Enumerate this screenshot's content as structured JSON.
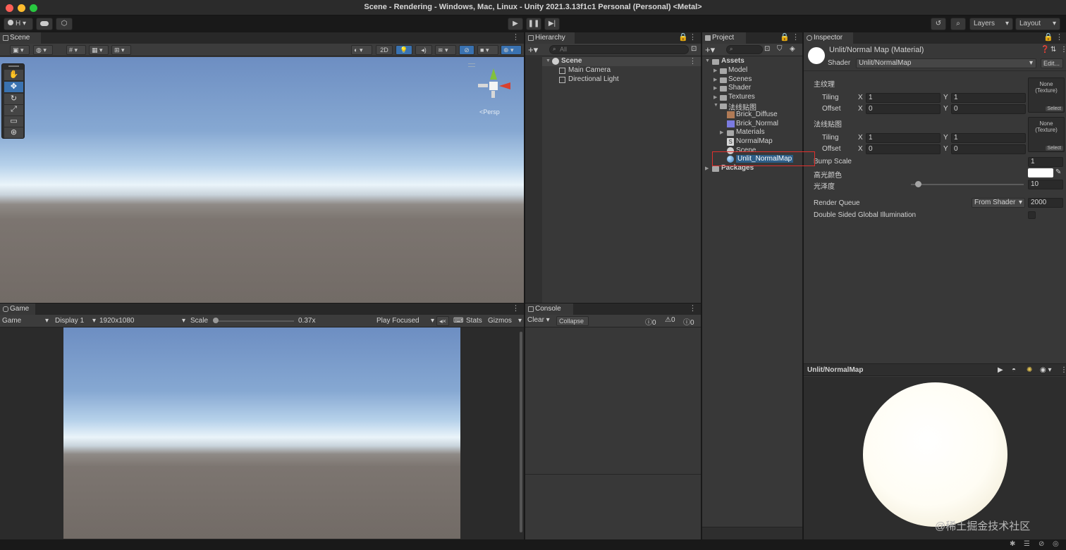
{
  "window": {
    "title": "Scene - Rendering - Windows, Mac, Linux - Unity 2021.3.13f1c1 Personal (Personal) <Metal>"
  },
  "toolbar": {
    "account": "H",
    "layers": "Layers",
    "layout": "Layout"
  },
  "scene": {
    "tab": "Scene",
    "btn_2d": "2D",
    "persp_label": "<Persp"
  },
  "game": {
    "tab": "Game",
    "view_select": "Game",
    "display": "Display 1",
    "resolution": "1920x1080",
    "scale_label": "Scale",
    "scale_value": "0.37x",
    "play_mode": "Play Focused",
    "stats": "Stats",
    "gizmos": "Gizmos"
  },
  "hierarchy": {
    "tab": "Hierarchy",
    "search_placeholder": "All",
    "items": [
      {
        "label": "Scene"
      },
      {
        "label": "Main Camera"
      },
      {
        "label": "Directional Light"
      }
    ]
  },
  "console": {
    "tab": "Console",
    "clear": "Clear",
    "collapse": "Collapse",
    "count_log": "0",
    "count_warn": "0",
    "count_error": "0"
  },
  "project": {
    "tab": "Project",
    "tree": [
      {
        "label": "Assets"
      },
      {
        "label": "Model"
      },
      {
        "label": "Scenes"
      },
      {
        "label": "Shader"
      },
      {
        "label": "Textures"
      },
      {
        "label": "法线贴图"
      },
      {
        "label": "Brick_Diffuse"
      },
      {
        "label": "Brick_Normal"
      },
      {
        "label": "Materials"
      },
      {
        "label": "NormalMap"
      },
      {
        "label": "Scene"
      },
      {
        "label": "Unlit_NormalMap"
      },
      {
        "label": "Packages"
      }
    ]
  },
  "inspector": {
    "tab": "Inspector",
    "material_name": "Unlit/Normal Map (Material)",
    "shader_label": "Shader",
    "shader_value": "Unlit/NormalMap",
    "edit_button": "Edit...",
    "tex1_label": "主纹理",
    "tex2_label": "法线贴图",
    "tiling": "Tiling",
    "offset": "Offset",
    "x": "X",
    "y": "Y",
    "tex1_tiling_x": "1",
    "tex1_tiling_y": "1",
    "tex1_offset_x": "0",
    "tex1_offset_y": "0",
    "tex2_tiling_x": "1",
    "tex2_tiling_y": "1",
    "tex2_offset_x": "0",
    "tex2_offset_y": "0",
    "slot_none": "None",
    "slot_type": "(Texture)",
    "slot_select": "Select",
    "bump_label": "Bump Scale",
    "bump_value": "1",
    "spec_color_label": "高光颜色",
    "gloss_label": "光泽度",
    "gloss_value": "10",
    "gloss_fraction": 0.06,
    "render_queue_label": "Render Queue",
    "render_queue_mode": "From Shader",
    "render_queue_value": "2000",
    "dsgi_label": "Double Sided Global Illumination",
    "preview_title": "Unlit/NormalMap"
  },
  "watermark": "@稀土掘金技术社区",
  "colors": {
    "selection": "#2c5d87",
    "highlight_box": "#e0302c",
    "accent_blue": "#3a72b0"
  }
}
